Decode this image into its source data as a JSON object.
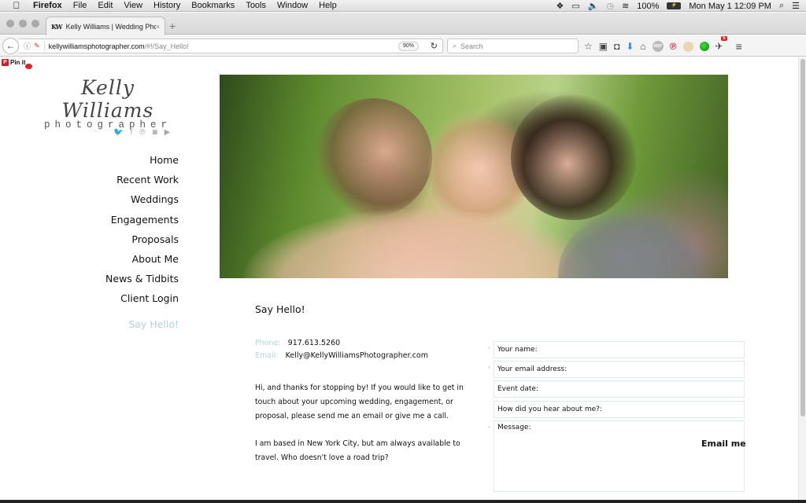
{
  "menubar": {
    "apple": "",
    "app": "Firefox",
    "items": [
      "File",
      "Edit",
      "View",
      "History",
      "Bookmarks",
      "Tools",
      "Window",
      "Help"
    ],
    "status": {
      "battery": "100%",
      "datetime": "Mon May 1  12:09 PM"
    }
  },
  "browser": {
    "tab": {
      "favicon": "KW",
      "title": "Kelly Williams | Wedding Phot",
      "close": "×"
    },
    "new_tab": "+",
    "url_host": "kellywilliamsphotographer.com",
    "url_path": "/#!/Say_Hello!",
    "zoom": "90%",
    "search_placeholder": "Search",
    "notification_badge": "5"
  },
  "page": {
    "pinit": "Pin it",
    "logo": {
      "script": "Kelly Williams",
      "sub": "photographer"
    },
    "social": [
      "twitter-icon",
      "facebook-icon",
      "pinterest-icon",
      "instagram-icon",
      "youtube-icon"
    ],
    "social_glyphs": [
      "🐦",
      "f",
      "℗",
      "◙",
      "▶"
    ],
    "nav": [
      "Home",
      "Recent Work",
      "Weddings",
      "Engagements",
      "Proposals",
      "About Me",
      "News & Tidbits",
      "Client Login"
    ],
    "nav_active": "Say Hello!",
    "title": "Say Hello!",
    "contact": {
      "phone_label": "Phone:",
      "phone": "917.613.5260",
      "email_label": "Email:",
      "email": "Kelly@KellyWilliamsPhotographer.com"
    },
    "body": [
      "Hi, and thanks for stopping by!  If you would like to get in touch about your upcoming wedding, engagement, or proposal, please send me an email or give me a call.",
      "I am based in New York City, but am always available to travel. Who doesn't love a road trip?"
    ],
    "form": {
      "name_placeholder": "Your name:",
      "email_placeholder": "Your email address:",
      "date_placeholder": "Event date:",
      "hear_placeholder": "How did you hear about me?:",
      "message_placeholder": "Message:",
      "required_mark": "*",
      "submit": "Email me"
    },
    "colors": {
      "accent": "#b2d0d8",
      "label": "#b7d3da",
      "field_border": "#dde9ec"
    }
  }
}
